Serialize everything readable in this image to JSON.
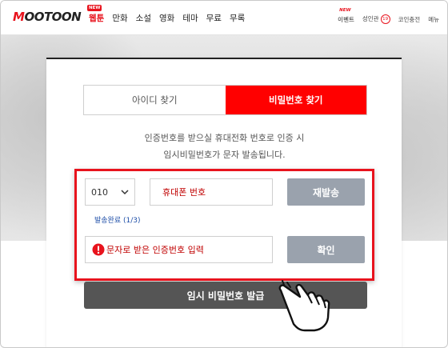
{
  "header": {
    "logo": "MOOTOON",
    "menu": [
      {
        "label": "웹툰",
        "badge": "NEW",
        "active": true
      },
      {
        "label": "만화"
      },
      {
        "label": "소설"
      },
      {
        "label": "영화"
      },
      {
        "label": "테마"
      },
      {
        "label": "무료"
      },
      {
        "label": "무록"
      }
    ],
    "util": {
      "event_badge": "NEW",
      "event": "이벤트",
      "adult": "성인관",
      "adult_badge": "19",
      "coin": "코인충전",
      "menu": "메뉴"
    }
  },
  "modal": {
    "tabs": [
      {
        "label": "아이디 찾기",
        "active": false
      },
      {
        "label": "비밀번호 찾기",
        "active": true
      }
    ],
    "description_line1": "인증번호를 받으실 휴대전화 번호로 인증 시",
    "description_line2": "임시비밀번호가 문자 발송됩니다.",
    "country_code": "010",
    "phone_placeholder": "휴대폰 번호",
    "resend_button": "재발송",
    "sent_status": "발송완료 (1/3)",
    "code_placeholder": "문자로 받은 인증번호 입력",
    "confirm_button": "확인",
    "issue_button": "임시 비밀번호 발급"
  },
  "colors": {
    "accent": "#e8131d",
    "active_tab": "#ff0000",
    "gray_button": "#9aa2ad",
    "dark_button": "#555555",
    "link_blue": "#1f4fa8"
  },
  "icons": [
    "chevron-down-icon",
    "exclamation-icon",
    "pointing-hand-icon"
  ]
}
